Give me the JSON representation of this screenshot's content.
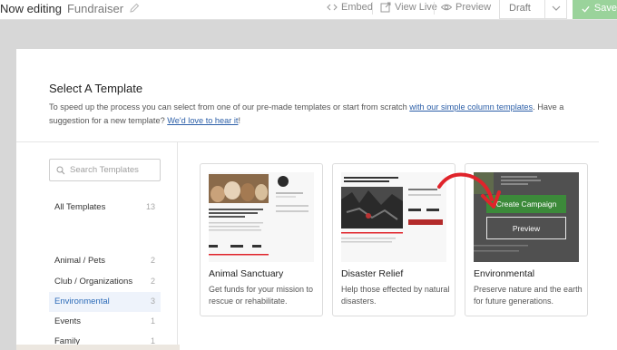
{
  "topbar": {
    "editing_label": "Now editing",
    "campaign_name": "Fundraiser",
    "actions": [
      {
        "label": "Embed",
        "icon": "code-icon"
      },
      {
        "label": "View Live",
        "icon": "external-link-icon"
      },
      {
        "label": "Preview",
        "icon": "eye-icon"
      }
    ],
    "status_select": "Draft",
    "save_label": "Save"
  },
  "modal": {
    "title": "Select A Template",
    "intro_before": "To speed up the process you can select from one of our pre-made templates or start from scratch ",
    "intro_link1": "with our simple column templates",
    "intro_middle": ". Have a suggestion for a new template? ",
    "intro_link2": "We'd love to hear it",
    "intro_after": "!"
  },
  "sidebar": {
    "search_placeholder": "Search Templates",
    "all_templates": {
      "label": "All Templates",
      "count": "13"
    },
    "categories": [
      {
        "label": "Animal / Pets",
        "count": "2"
      },
      {
        "label": "Club / Organizations",
        "count": "2"
      },
      {
        "label": "Environmental",
        "count": "3",
        "active": true
      },
      {
        "label": "Events",
        "count": "1"
      },
      {
        "label": "Family",
        "count": "1"
      }
    ]
  },
  "templates": [
    {
      "title": "Animal Sanctuary",
      "desc": "Get funds for your mission to rescue or rehabilitate."
    },
    {
      "title": "Disaster Relief",
      "desc": "Help those effected by natural disasters."
    },
    {
      "title": "Environmental",
      "desc": "Preserve nature and the earth for future generations.",
      "hover_create": "Create Campaign",
      "hover_preview": "Preview"
    }
  ],
  "colors": {
    "accent_blue": "#2c6bb8",
    "save_green": "#9ad39b",
    "create_green": "#3c8a3a",
    "arrow_red": "#e0242b"
  }
}
